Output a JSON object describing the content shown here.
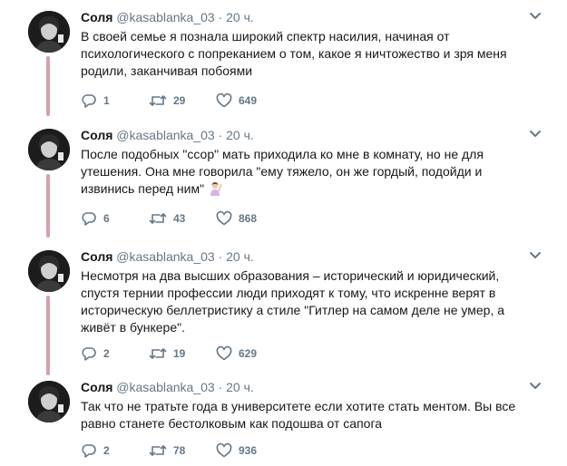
{
  "tweets": [
    {
      "name": "Соля",
      "handle": "@kasablanka_03",
      "dot": "·",
      "time": "20 ч.",
      "text": "В своей семье я познала широкий спектр насилия, начиная от психологического с попреканием о том, какое я ничтожество и зря меня родили, заканчивая побоями",
      "replies": "1",
      "retweets": "29",
      "likes": "649"
    },
    {
      "name": "Соля",
      "handle": "@kasablanka_03",
      "dot": "·",
      "time": "20 ч.",
      "text": "После подобных \"ссор\" мать приходила ко мне в комнату, но не для утешения. Она мне говорила \"ему тяжело, он же гордый, подойди и извинись перед ним\"",
      "emoji": "person-raising-hand-emoji",
      "replies": "6",
      "retweets": "43",
      "likes": "868"
    },
    {
      "name": "Соля",
      "handle": "@kasablanka_03",
      "dot": "·",
      "time": "20 ч.",
      "text": "Несмотря на два высших образования – исторический и юридический, спустя тернии профессии люди приходят к тому, что искренне верят в историческую беллетристику а стиле \"Гитлер на самом деле не умер, а живёт в бункере\".",
      "replies": "2",
      "retweets": "19",
      "likes": "629"
    },
    {
      "name": "Соля",
      "handle": "@kasablanka_03",
      "dot": "·",
      "time": "20 ч.",
      "text": "Так что не тратьте года в университете если хотите стать ментом. Вы все равно станете бестолковым как подошва от сапога",
      "replies": "2",
      "retweets": "78",
      "likes": "936"
    }
  ],
  "colors": {
    "thread_line": "#d7a0a9",
    "muted": "#657786",
    "text": "#14171a",
    "divider": "#e6ecf0"
  },
  "icons": [
    "reply-icon",
    "retweet-icon",
    "like-icon",
    "chevron-down-icon"
  ]
}
